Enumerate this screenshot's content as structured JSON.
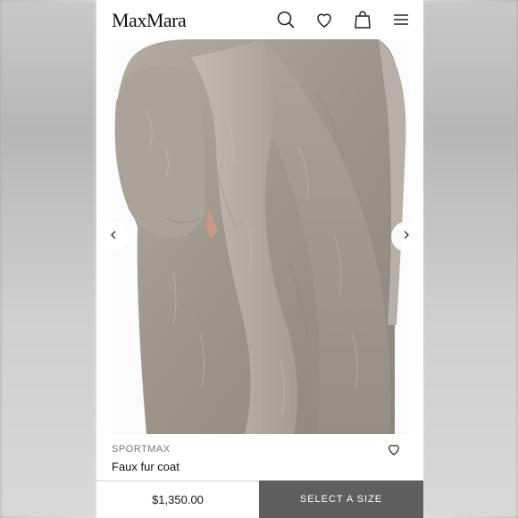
{
  "header": {
    "logo": "MaxMara",
    "icons": [
      "search-icon",
      "heart-icon",
      "bag-icon",
      "menu-icon"
    ]
  },
  "gallery": {
    "image": "grey faux fur coat product photo",
    "prev_icon": "chevron-left-icon",
    "next_icon": "chevron-right-icon"
  },
  "product": {
    "brand": "SPORTMAX",
    "name": "Faux fur coat",
    "wishlist_icon": "heart-icon"
  },
  "purchase": {
    "price": "$1,350.00",
    "cta": "SELECT A SIZE"
  },
  "colors": {
    "cta_bg": "#5f5f5f",
    "fur": "#a39c93"
  }
}
